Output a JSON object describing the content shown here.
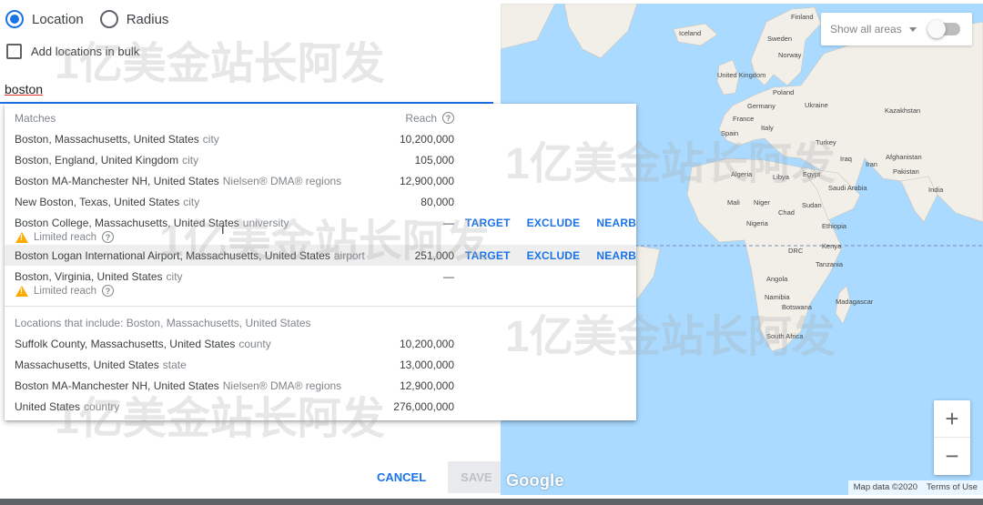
{
  "targeting": {
    "radio_location": "Location",
    "radio_radius": "Radius",
    "bulk_label": "Add locations in bulk",
    "search_value": "boston"
  },
  "dropdown": {
    "header_matches": "Matches",
    "header_reach": "Reach",
    "matches": [
      {
        "name": "Boston, Massachusetts, United States",
        "type": "city",
        "reach": "10,200,000"
      },
      {
        "name": "Boston, England, United Kingdom",
        "type": "city",
        "reach": "105,000"
      },
      {
        "name": "Boston MA-Manchester NH, United States",
        "type": "Nielsen® DMA® regions",
        "reach": "12,900,000"
      },
      {
        "name": "New Boston, Texas, United States",
        "type": "city",
        "reach": "80,000"
      },
      {
        "name": "Boston College, Massachusetts, United States",
        "type": "university",
        "reach": "—",
        "warning": "Limited reach"
      },
      {
        "name": "Boston Logan International Airport, Massachusetts, United States",
        "type": "airport",
        "reach": "251,000"
      },
      {
        "name": "Boston, Virginia, United States",
        "type": "city",
        "reach": "—",
        "warning": "Limited reach"
      }
    ],
    "actions": {
      "target": "TARGET",
      "exclude": "EXCLUDE",
      "nearby": "NEARBY"
    },
    "include_header": "Locations that include: Boston, Massachusetts, United States",
    "includes": [
      {
        "name": "Suffolk County, Massachusetts, United States",
        "type": "county",
        "reach": "10,200,000"
      },
      {
        "name": "Massachusetts, United States",
        "type": "state",
        "reach": "13,000,000"
      },
      {
        "name": "Boston MA-Manchester NH, United States",
        "type": "Nielsen® DMA® regions",
        "reach": "12,900,000"
      },
      {
        "name": "United States",
        "type": "country",
        "reach": "276,000,000"
      }
    ]
  },
  "footer": {
    "cancel": "CANCEL",
    "save": "SAVE"
  },
  "map": {
    "show_all_areas": "Show all areas",
    "zoom_in": "+",
    "zoom_out": "−",
    "google": "Google",
    "map_data": "Map data ©2020",
    "terms": "Terms of Use",
    "labels": [
      "Iceland",
      "Finland",
      "Sweden",
      "Norway",
      "United Kingdom",
      "Poland",
      "Germany",
      "Ukraine",
      "France",
      "Kazakhstan",
      "Spain",
      "Italy",
      "Turkey",
      "Iraq",
      "Iran",
      "Afghanistan",
      "Pakistan",
      "Algeria",
      "Libya",
      "Egypt",
      "Saudi Arabia",
      "India",
      "Mali",
      "Niger",
      "Sudan",
      "Chad",
      "Nigeria",
      "Ethiopia",
      "Kenya",
      "DRC",
      "Tanzania",
      "Angola",
      "Namibia",
      "Botswana",
      "Madagascar",
      "South Africa"
    ]
  },
  "watermark": "1亿美金站长阿发",
  "colors": {
    "accent": "#1a73e8",
    "warning": "#f9ab00",
    "ocean": "#aadaff",
    "land": "#f2efe9"
  }
}
